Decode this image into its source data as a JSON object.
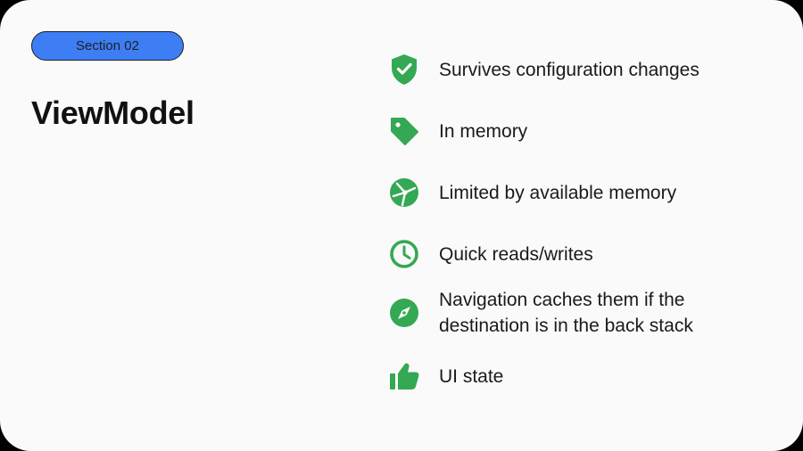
{
  "slide": {
    "section_label": "Section 02",
    "title": "ViewModel"
  },
  "features": [
    {
      "icon": "shield-check-icon",
      "label": "Survives configuration changes"
    },
    {
      "icon": "tag-icon",
      "label": "In memory"
    },
    {
      "icon": "memory-chip-icon",
      "label": "Limited by available memory"
    },
    {
      "icon": "clock-icon",
      "label": "Quick reads/writes"
    },
    {
      "icon": "compass-icon",
      "label": "Navigation caches them if the destination is in the back stack"
    },
    {
      "icon": "thumbs-up-icon",
      "label": "UI state"
    }
  ],
  "colors": {
    "pill_fill": "#3d7ef5",
    "icon_green": "#34a853",
    "text": "#1a1a1a"
  }
}
